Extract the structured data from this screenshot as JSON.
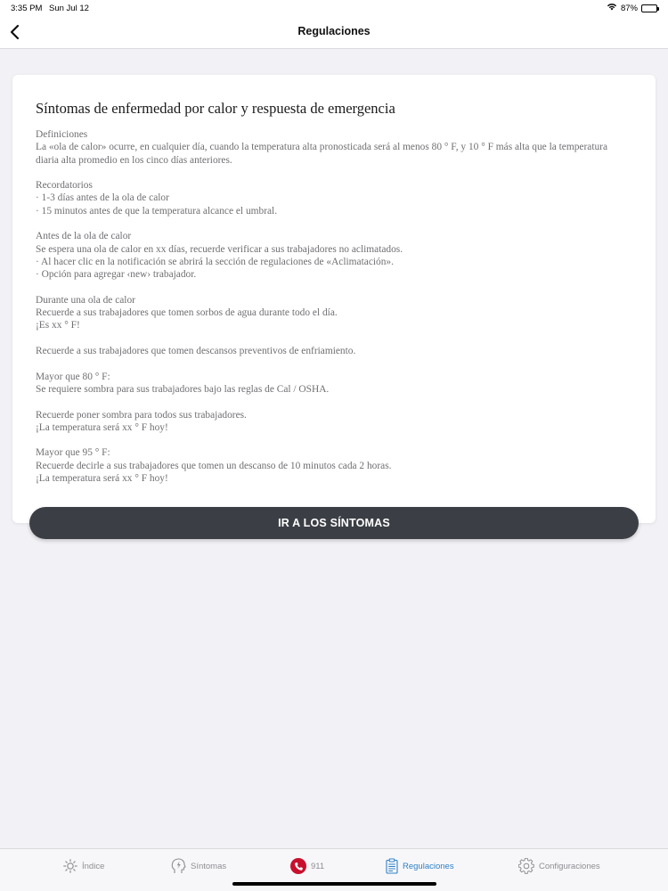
{
  "status_bar": {
    "time": "3:35 PM",
    "date": "Sun Jul 12",
    "battery": "87%",
    "battery_level": 0.87
  },
  "nav": {
    "title": "Regulaciones"
  },
  "card": {
    "title": "Síntomas de enfermedad por calor y respuesta de emergencia",
    "paragraphs": [
      [
        "Definiciones",
        "La «ola de calor» ocurre, en cualquier día, cuando la temperatura alta pronosticada será al menos 80 ° F, y 10 ° F más alta que la temperatura diaria alta promedio en los cinco días anteriores."
      ],
      [
        "Recordatorios",
        "· 1-3 días antes de la ola de calor",
        "· 15 minutos antes de que la temperatura alcance el umbral."
      ],
      [
        "Antes de la ola de calor",
        "Se espera una ola de calor en xx días, recuerde verificar a sus trabajadores no aclimatados.",
        "· Al hacer clic en la notificación se abrirá la sección de regulaciones de «Aclimatación».",
        "· Opción para agregar ‹new› trabajador."
      ],
      [
        "Durante una ola de calor",
        "Recuerde a sus trabajadores que tomen sorbos de agua durante todo el día.",
        "¡Es xx ° F!"
      ],
      [
        "Recuerde a sus trabajadores que tomen descansos preventivos de enfriamiento."
      ],
      [
        "Mayor que 80 ° F:",
        "Se requiere sombra para sus trabajadores bajo las reglas de Cal / OSHA."
      ],
      [
        "Recuerde poner sombra para todos sus trabajadores.",
        "¡La temperatura será xx ° F hoy!"
      ],
      [
        "Mayor que 95 ° F:",
        "Recuerde decirle a sus trabajadores que tomen un descanso de 10 minutos cada 2 horas.",
        "¡La temperatura será xx ° F hoy!"
      ]
    ]
  },
  "cta": {
    "label": "IR A LOS SÍNTOMAS"
  },
  "tabs": [
    {
      "label": "Índice",
      "icon": "sun-icon",
      "active": false
    },
    {
      "label": "Síntomas",
      "icon": "head-bolt-icon",
      "active": false
    },
    {
      "label": "911",
      "icon": "emergency-phone-icon",
      "active": false
    },
    {
      "label": "Regulaciones",
      "icon": "clipboard-icon",
      "active": true
    },
    {
      "label": "Configuraciones",
      "icon": "gear-icon",
      "active": false
    }
  ],
  "colors": {
    "accent": "#2f80c6",
    "cta_background": "#3b3f45",
    "emergency": "#c8102e",
    "inactive": "#8e8e93"
  }
}
